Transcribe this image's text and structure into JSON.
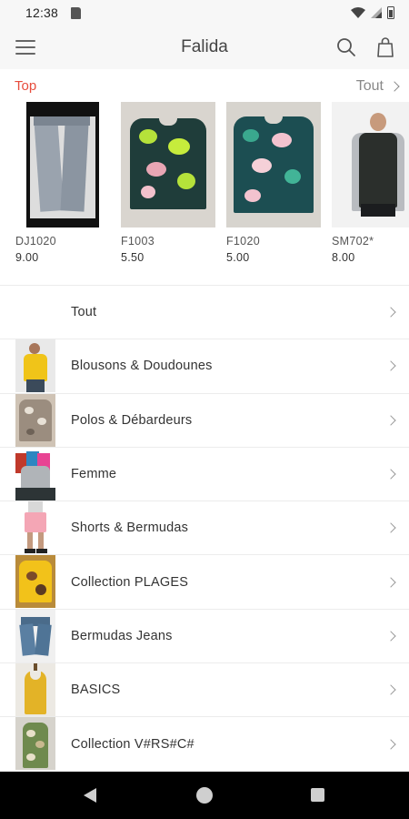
{
  "status_bar": {
    "time": "12:38"
  },
  "app_bar": {
    "title": "Falida"
  },
  "top_section": {
    "label": "Top",
    "see_all": "Tout"
  },
  "products": [
    {
      "code": "DJ1020",
      "price": "9.00"
    },
    {
      "code": "F1003",
      "price": "5.50"
    },
    {
      "code": "F1020",
      "price": "5.00"
    },
    {
      "code": "SM702*",
      "price": "8.00"
    }
  ],
  "categories": [
    {
      "label": "Tout"
    },
    {
      "label": "Blousons & Doudounes"
    },
    {
      "label": "Polos & Débardeurs"
    },
    {
      "label": "Femme"
    },
    {
      "label": "Shorts & Bermudas"
    },
    {
      "label": "Collection PLAGES"
    },
    {
      "label": "Bermudas Jeans"
    },
    {
      "label": "BASICS"
    },
    {
      "label": "Collection V#RS#C#"
    }
  ],
  "colors": {
    "accent": "#e74c3c",
    "nav_bar": "#000000"
  },
  "icons": [
    "sd-card-icon",
    "wifi-icon",
    "signal-icon",
    "battery-icon",
    "menu-icon",
    "search-icon",
    "shopping-bag-icon",
    "chevron-right-icon",
    "back-icon",
    "home-icon",
    "recents-icon"
  ]
}
